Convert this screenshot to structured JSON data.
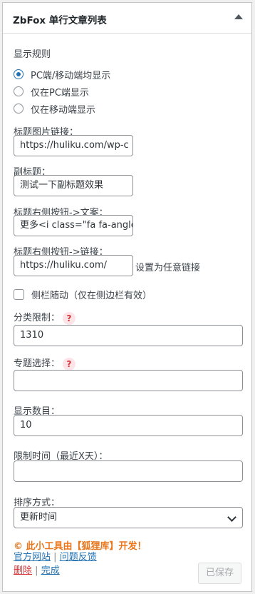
{
  "widget": {
    "title": "ZbFox 单行文章列表"
  },
  "display_rule": {
    "label": "显示规则",
    "options": [
      "PC端/移动端均显示",
      "仅在PC端显示",
      "仅在移动端显示"
    ],
    "selected": 0
  },
  "title_image_link": {
    "label": "标题图片链接：",
    "value": "https://huliku.com/wp-c"
  },
  "subtitle": {
    "label": "副标题：",
    "value": "测试一下副标题效果"
  },
  "title_button_text": {
    "label": "标题右侧按钮->文案：",
    "value": "更多<i class=\"fa fa-angle"
  },
  "title_button_link": {
    "label": "标题右侧按钮->链接：",
    "value": "https://huliku.com/",
    "note": "设置为任意链接"
  },
  "sidebar_follow": {
    "label": "侧栏随动（仅在侧边栏有效）",
    "checked": false
  },
  "category_limit": {
    "label": "分类限制：",
    "help": "?",
    "value": "1310"
  },
  "topic_select": {
    "label": "专题选择：",
    "help": "?",
    "value": ""
  },
  "display_count": {
    "label": "显示数目：",
    "value": "10"
  },
  "time_limit": {
    "label": "限制时间（最近X天）：",
    "value": ""
  },
  "sort": {
    "label": "排序方式：",
    "value": "更新时间"
  },
  "footer": {
    "promo": "© 此小工具由【狐狸库】开发！",
    "official_site": "官方网站",
    "feedback": "问题反馈",
    "delete": "删除",
    "done": "完成",
    "separator": "|",
    "save": "已保存"
  },
  "colors": {
    "accent": "#2271b1",
    "promo": "#e8761c",
    "danger": "#d63638"
  }
}
